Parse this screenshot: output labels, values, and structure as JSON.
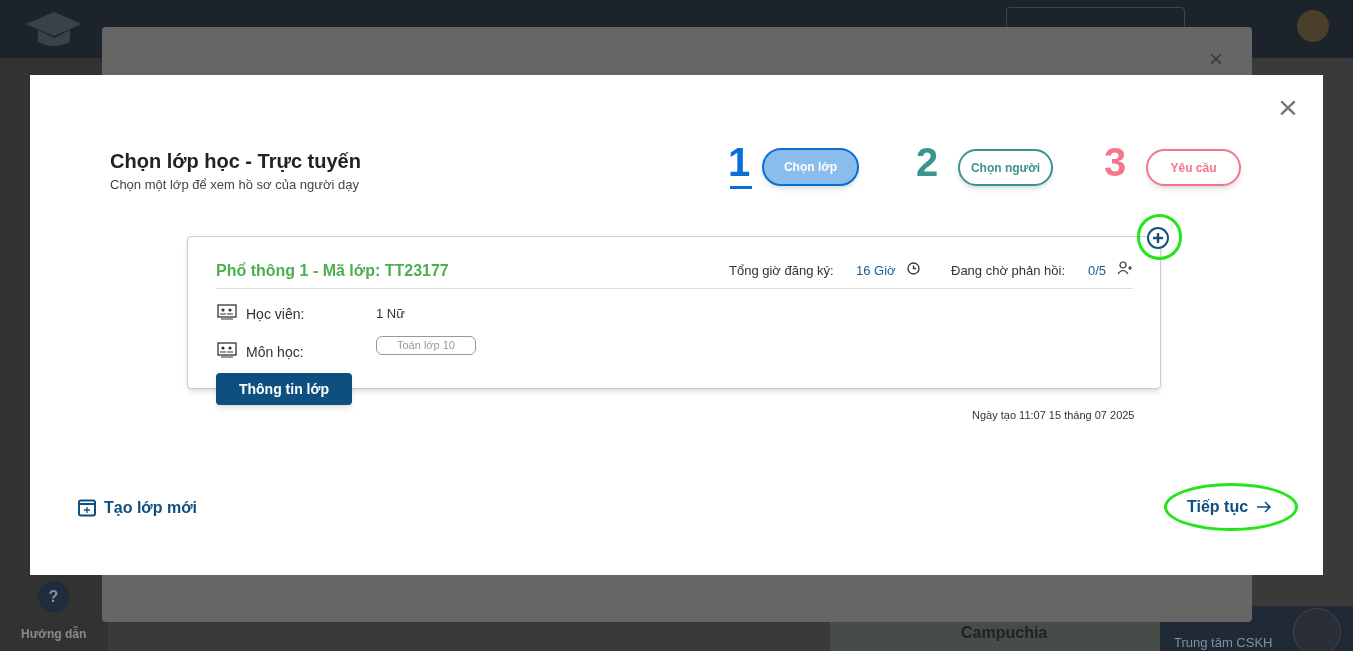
{
  "sidebar": {
    "help_icon": "?",
    "help": "Hướng dẫn"
  },
  "map": {
    "label": "Campuchia"
  },
  "support": {
    "subtitle": "Trung tâm CSKH"
  },
  "background_dialog": {
    "close": "×"
  },
  "dialog": {
    "close": "×",
    "title": "Chọn lớp học - Trực tuyến",
    "subtitle": "Chọn một lớp để xem hồ sơ của người dạy",
    "steps": [
      {
        "number": "1",
        "label": "Chọn lớp",
        "selected": true,
        "color": "#0a6fd6"
      },
      {
        "number": "2",
        "label": "Chọn người",
        "selected": false,
        "color": "#3a9490"
      },
      {
        "number": "3",
        "label": "Yêu cầu",
        "selected": false,
        "color": "#f5768c"
      }
    ],
    "class_card": {
      "title": "Phổ thông 1 - Mã lớp: TT23177",
      "hours_label": "Tổng giờ đăng ký:",
      "hours": "16 Giờ",
      "pending_label": "Đang chờ phản hồi:",
      "pending": "0/5",
      "add_highlighted": true,
      "rows": [
        {
          "kind": "text",
          "label": "Học viên:",
          "value": "1 Nữ"
        },
        {
          "kind": "tag",
          "label": "Môn học:",
          "value": "Toán lớp 10"
        }
      ],
      "info_button": "Thông tin lớp"
    },
    "created": "Ngày tạo 11:07 15 tháng 07 2025",
    "new_class": "Tạo lớp mới",
    "continue": {
      "label": "Tiếp tục",
      "highlighted": true
    }
  }
}
